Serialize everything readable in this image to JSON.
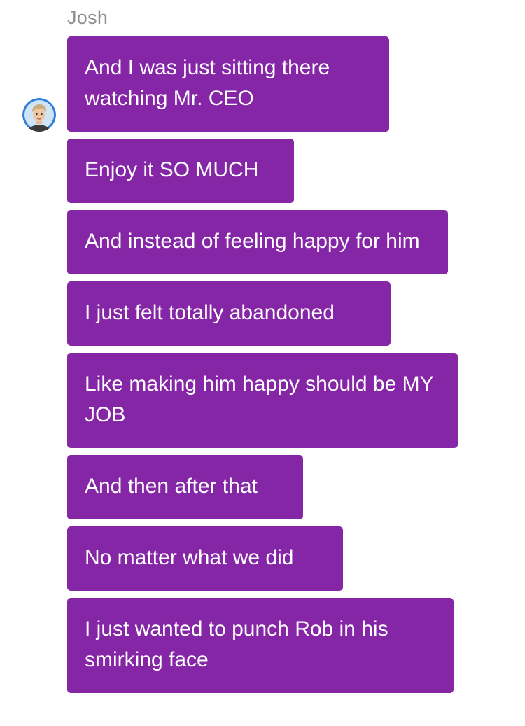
{
  "sender": {
    "name": "Josh",
    "avatar_icon": "user-avatar-icon"
  },
  "colors": {
    "bubble": "#8526a6",
    "bubble_text": "#ffffff",
    "sender_name": "#8e8e93"
  },
  "messages": [
    {
      "text": "And I was just sitting there watching Mr. CEO"
    },
    {
      "text": "Enjoy it SO MUCH"
    },
    {
      "text": "And instead of feeling happy for him"
    },
    {
      "text": "I just felt totally abandoned"
    },
    {
      "text": "Like making him happy should be MY JOB"
    },
    {
      "text": "And then after that"
    },
    {
      "text": "No matter what we did"
    },
    {
      "text": "I just wanted to punch Rob in his smirking face"
    }
  ]
}
